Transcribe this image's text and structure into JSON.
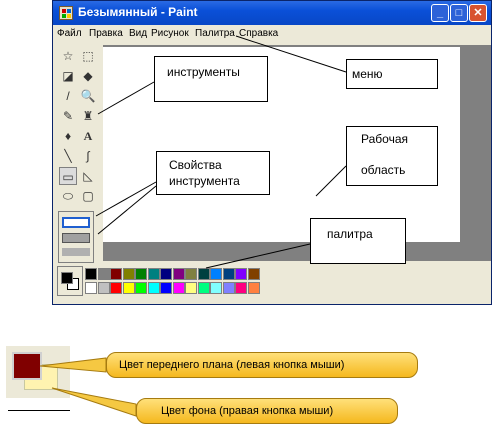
{
  "window": {
    "title": "Безымянный - Paint",
    "buttons": {
      "minimize": "_",
      "maximize": "□",
      "close": "✕"
    }
  },
  "menu": [
    "Файл",
    "Правка",
    "Вид",
    "Рисунок",
    "Палитра",
    "Справка"
  ],
  "tools": [
    {
      "name": "free-select",
      "glyph": "☆"
    },
    {
      "name": "rect-select",
      "glyph": "⬚"
    },
    {
      "name": "eraser",
      "glyph": "◪"
    },
    {
      "name": "fill",
      "glyph": "◆"
    },
    {
      "name": "color-picker",
      "glyph": "/"
    },
    {
      "name": "magnifier",
      "glyph": "🔍"
    },
    {
      "name": "pencil",
      "glyph": "✎"
    },
    {
      "name": "brush",
      "glyph": "♜"
    },
    {
      "name": "airbrush",
      "glyph": "♦"
    },
    {
      "name": "text",
      "glyph": "A"
    },
    {
      "name": "line",
      "glyph": "╲"
    },
    {
      "name": "curve",
      "glyph": "∫"
    },
    {
      "name": "rectangle",
      "glyph": "▭"
    },
    {
      "name": "polygon",
      "glyph": "◺"
    },
    {
      "name": "ellipse",
      "glyph": "⬭"
    },
    {
      "name": "rounded-rect",
      "glyph": "▢"
    }
  ],
  "palette": {
    "foreground": "#000000",
    "background": "#ffffff",
    "row1": [
      "#000000",
      "#808080",
      "#800000",
      "#808000",
      "#008000",
      "#008080",
      "#000080",
      "#800080",
      "#808040",
      "#004040",
      "#0080ff",
      "#004080",
      "#8000ff",
      "#804000"
    ],
    "row2": [
      "#ffffff",
      "#c0c0c0",
      "#ff0000",
      "#ffff00",
      "#00ff00",
      "#00ffff",
      "#0000ff",
      "#ff00ff",
      "#ffff80",
      "#00ff80",
      "#80ffff",
      "#8080ff",
      "#ff0080",
      "#ff8040"
    ]
  },
  "callouts": {
    "tools": "инструменты",
    "menu": "меню",
    "workspace_line1": "Рабочая",
    "workspace_line2": "область",
    "tool_props_line1": "Свойства",
    "tool_props_line2": "инструмента",
    "palette": "палитра"
  },
  "legend": {
    "foreground_label": "Цвет переднего плана (левая кнопка мыши)",
    "background_label": "Цвет фона (правая кнопка мыши)",
    "foreground_color": "#800000",
    "background_color": "#fff3b0"
  }
}
